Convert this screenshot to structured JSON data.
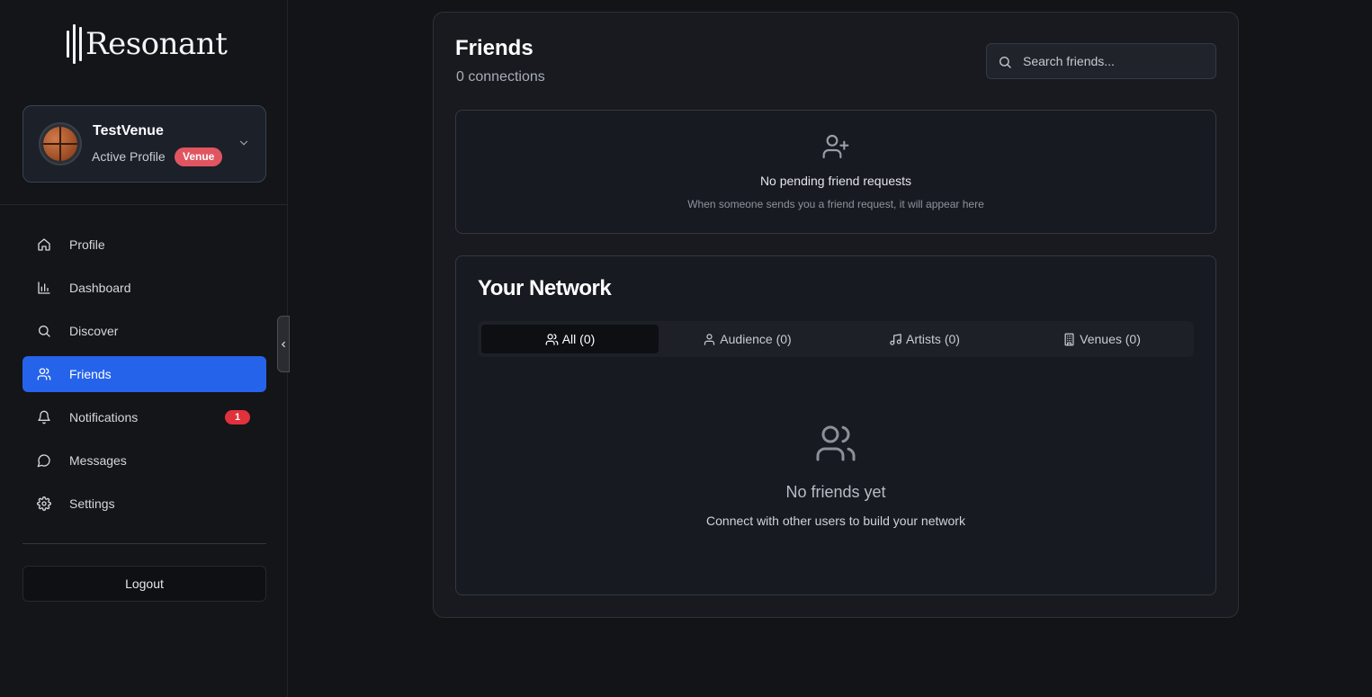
{
  "app": {
    "name": "Resonant"
  },
  "profile_card": {
    "name": "TestVenue",
    "subtitle": "Active Profile",
    "badge": "Venue",
    "avatar_icon": "basketball-avatar",
    "chevron_icon": "chevron-down-icon"
  },
  "sidebar": {
    "items": [
      {
        "label": "Profile",
        "icon": "home-icon"
      },
      {
        "label": "Dashboard",
        "icon": "bar-chart-icon"
      },
      {
        "label": "Discover",
        "icon": "search-icon"
      },
      {
        "label": "Friends",
        "icon": "users-icon",
        "active": true
      },
      {
        "label": "Notifications",
        "icon": "bell-icon",
        "badge": "1"
      },
      {
        "label": "Messages",
        "icon": "message-circle-icon"
      },
      {
        "label": "Settings",
        "icon": "gear-icon"
      }
    ],
    "logout_label": "Logout"
  },
  "main": {
    "title": "Friends",
    "subtitle": "0 connections",
    "search": {
      "placeholder": "Search friends...",
      "value": ""
    },
    "pending": {
      "title": "No pending friend requests",
      "subtitle": "When someone sends you a friend request, it will appear here"
    },
    "network": {
      "title": "Your Network",
      "tabs": [
        {
          "label": "All (0)",
          "icon": "users-icon",
          "active": true
        },
        {
          "label": "Audience (0)",
          "icon": "user-icon"
        },
        {
          "label": "Artists (0)",
          "icon": "music-icon"
        },
        {
          "label": "Venues (0)",
          "icon": "building-icon"
        }
      ],
      "empty_title": "No friends yet",
      "empty_subtitle": "Connect with other users to build your network"
    }
  },
  "colors": {
    "accent": "#2563eb",
    "badge_red": "#e0323c",
    "venue_badge": "#e05560",
    "background": "#131418"
  }
}
